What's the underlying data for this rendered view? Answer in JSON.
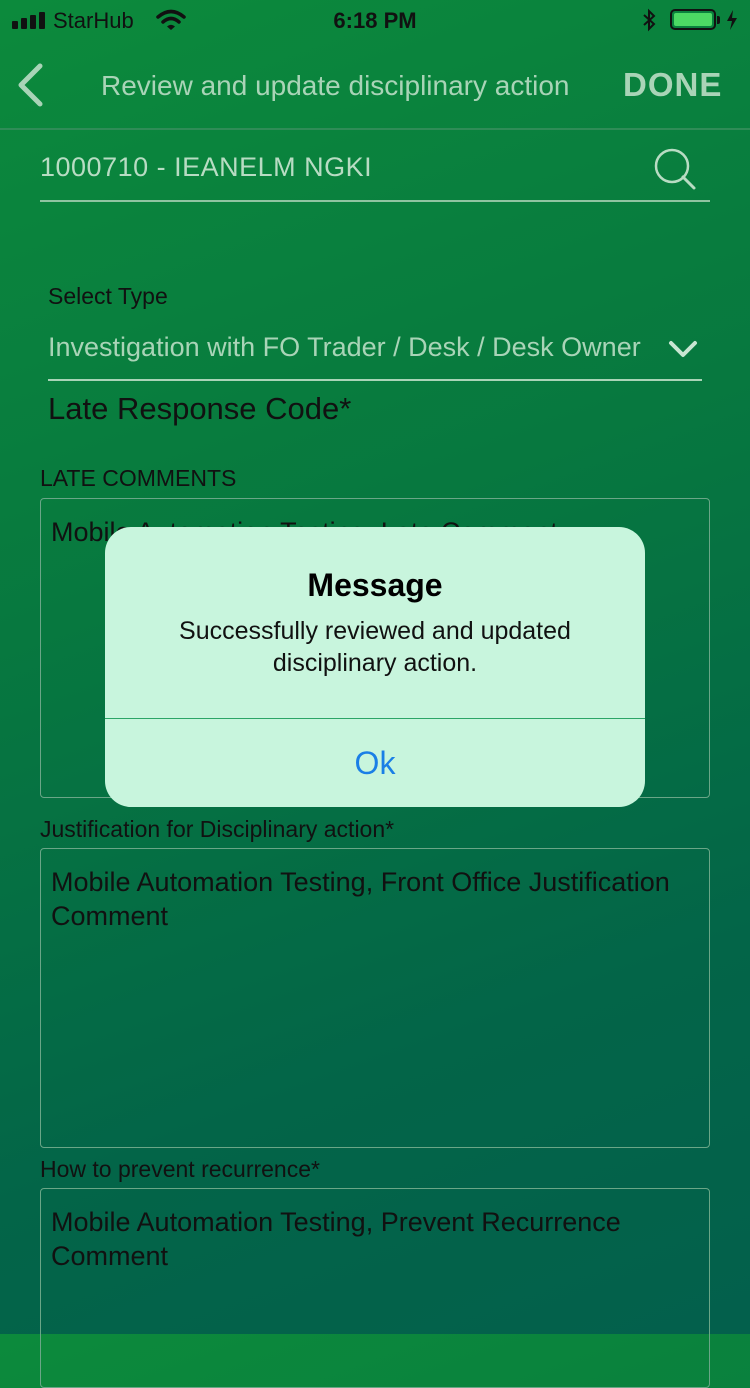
{
  "status_bar": {
    "carrier": "StarHub",
    "time": "6:18 PM",
    "battery_level": 1.0,
    "battery_color": "#4cd964"
  },
  "nav": {
    "back_icon": "chevron-left-icon",
    "title": "Review and update disciplinary action",
    "done_label": "DONE"
  },
  "search": {
    "value": "1000710 - IEANELM NGKI",
    "icon": "search-icon"
  },
  "select_type": {
    "label": "Select Type",
    "value": "Investigation with FO Trader / Desk / Desk Owner",
    "icon": "chevron-down-icon"
  },
  "late_response_code": "Late Response Code*",
  "late_comments": {
    "label": "LATE COMMENTS",
    "value": "Mobile Automation Testing, Late Comment"
  },
  "justification": {
    "label": "Justification for Disciplinary action*",
    "value": "Mobile Automation Testing, Front Office Justification Comment"
  },
  "prevent": {
    "label": "How to prevent recurrence*",
    "value": "Mobile Automation Testing, Prevent Recurrence Comment"
  },
  "alert": {
    "title": "Message",
    "message": "Successfully reviewed and updated disciplinary action.",
    "ok_label": "Ok",
    "ok_color": "#1a7fe6"
  },
  "colors": {
    "background_top": "#0c8a3c",
    "background_bottom": "#03604c",
    "dim_text": "#a9d4b7"
  }
}
